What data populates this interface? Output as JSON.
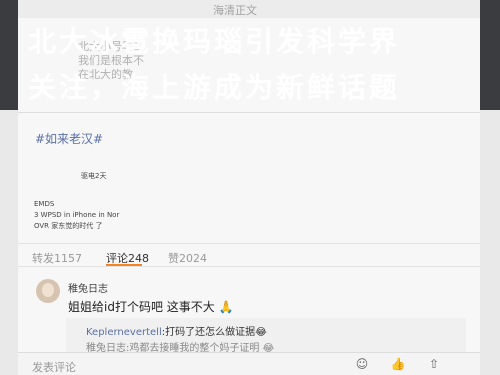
{
  "headline": {
    "line1": "北大冰雹换玛瑙引发科学界",
    "line2": "关注，海上游成为新鲜话题"
  },
  "topbar": {
    "title": "海清正文"
  },
  "faded_text": [
    "北大小号早1",
    "我们是根本不",
    "在北大的教"
  ],
  "post": {
    "hashtag": "#如来老汉#",
    "card_lines": [
      "驱电2天",
      "EMDS",
      "3 WPSD in iPhone in Nor",
      "OVR 家东觉的时代 了"
    ]
  },
  "tabs": {
    "repost": "转发1157",
    "comment": "评论248",
    "like": "赞2024"
  },
  "comment": {
    "username": "稚兔日志",
    "text": "姐姐给id打个码吧 这事不大 🙏",
    "reply_user": "Keplernevertell",
    "reply_text": ":打码了还怎么做证据😂",
    "reply2": "稚兔日志:鸡都去接睡我的整个妈子证明 😂"
  },
  "bottombar": {
    "placeholder": "发表评论",
    "icons": [
      "smile-icon",
      "thumbs-up-icon",
      "share-icon"
    ]
  }
}
